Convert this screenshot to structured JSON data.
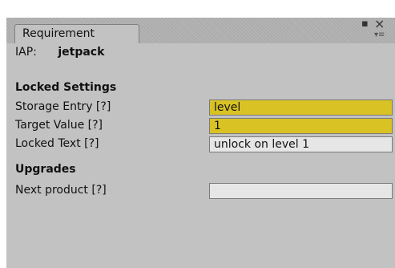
{
  "window": {
    "tab_title": "Requirement",
    "controls": {
      "maximize_icon": "maximize-icon",
      "close_icon": "close-icon",
      "menu_icon": "panel-menu-icon"
    }
  },
  "iap": {
    "label": "IAP:",
    "value": "jetpack"
  },
  "locked_settings": {
    "header": "Locked Settings",
    "storage_entry": {
      "label": "Storage Entry [?]",
      "value": "level"
    },
    "target_value": {
      "label": "Target Value [?]",
      "value": "1"
    },
    "locked_text": {
      "label": "Locked Text [?]",
      "value": "unlock on level 1"
    }
  },
  "upgrades": {
    "header": "Upgrades",
    "next_product": {
      "label": "Next product [?]",
      "value": ""
    }
  },
  "colors": {
    "panel_bg": "#c2c2c2",
    "highlight_field": "#d9c324",
    "field_bg": "#e6e6e6"
  }
}
